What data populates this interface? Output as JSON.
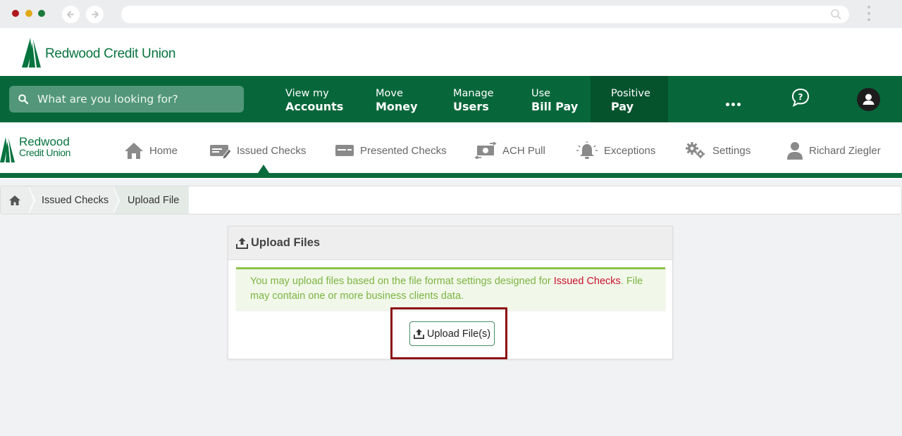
{
  "brand": {
    "name": "Redwood Credit Union",
    "small_line1": "Redwood",
    "small_line2": "Credit Union",
    "color": "#07743f"
  },
  "search": {
    "placeholder": "What are you looking for?"
  },
  "main_nav": [
    {
      "line1": "View my",
      "line2": "Accounts"
    },
    {
      "line1": "Move",
      "line2": "Money"
    },
    {
      "line1": "Manage",
      "line2": "Users"
    },
    {
      "line1": "Use",
      "line2": "Bill Pay"
    },
    {
      "line1": "Positive",
      "line2": "Pay",
      "active": true
    }
  ],
  "app_nav": {
    "home": "Home",
    "issued_checks": "Issued Checks",
    "presented_checks": "Presented Checks",
    "ach_pull": "ACH Pull",
    "exceptions": "Exceptions",
    "settings": "Settings",
    "user": "Richard Ziegler"
  },
  "breadcrumb": {
    "level1": "Issued Checks",
    "level2": "Upload File"
  },
  "panel": {
    "title": "Upload Files",
    "message_before": "You may upload files based on the file format settings designed for ",
    "message_link": "Issued Checks",
    "message_after": ". File may contain one or more business clients data.",
    "button_label": "Upload File(s)"
  },
  "colors": {
    "nav_green": "#07673a",
    "nav_active": "#04532d",
    "alert_text": "#7cb342",
    "alert_highlight": "#c8102e",
    "callout_border": "#8b0f14"
  }
}
